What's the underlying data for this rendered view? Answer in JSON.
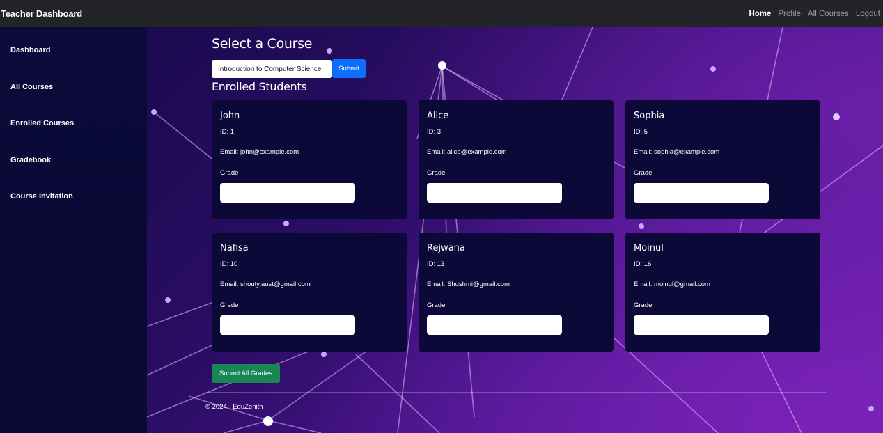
{
  "navbar": {
    "brand": "Teacher Dashboard",
    "links": [
      "Home",
      "Profile",
      "All Courses",
      "Logout"
    ]
  },
  "sidebar": {
    "items": [
      {
        "label": "Dashboard"
      },
      {
        "label": "All Courses"
      },
      {
        "label": "Enrolled Courses"
      },
      {
        "label": "Gradebook"
      },
      {
        "label": "Course Invitation"
      }
    ]
  },
  "main": {
    "select_heading": "Select a Course",
    "course_select_value": "Introduction to Computer Science",
    "submit_label": "Submit",
    "enrolled_heading": "Enrolled Students",
    "grade_label": "Grade",
    "students": [
      {
        "name": "John",
        "id": "ID: 1",
        "email": "Email: john@example.com",
        "grade": ""
      },
      {
        "name": "Alice",
        "id": "ID: 3",
        "email": "Email: alice@example.com",
        "grade": ""
      },
      {
        "name": "Sophia",
        "id": "ID: 5",
        "email": "Email: sophia@example.com",
        "grade": ""
      },
      {
        "name": "Nafisa",
        "id": "ID: 10",
        "email": "Email: shouty.aust@gmail.com",
        "grade": ""
      },
      {
        "name": "Rejwana",
        "id": "ID: 13",
        "email": "Email: Shushmi@gmail.com",
        "grade": ""
      },
      {
        "name": "Moinul",
        "id": "ID: 16",
        "email": "Email: moinul@gmail.com",
        "grade": ""
      }
    ],
    "submit_all_label": "Submit All Grades"
  },
  "footer": {
    "text": "© 2024 - EduZenith"
  },
  "colors": {
    "navbar_bg": "#222427",
    "sidebar_bg": "#0b0a3a",
    "card_bg": "#0c0838",
    "primary_button": "#0d6efd",
    "success_button": "#198754",
    "background_purple": "#6b1fae"
  }
}
